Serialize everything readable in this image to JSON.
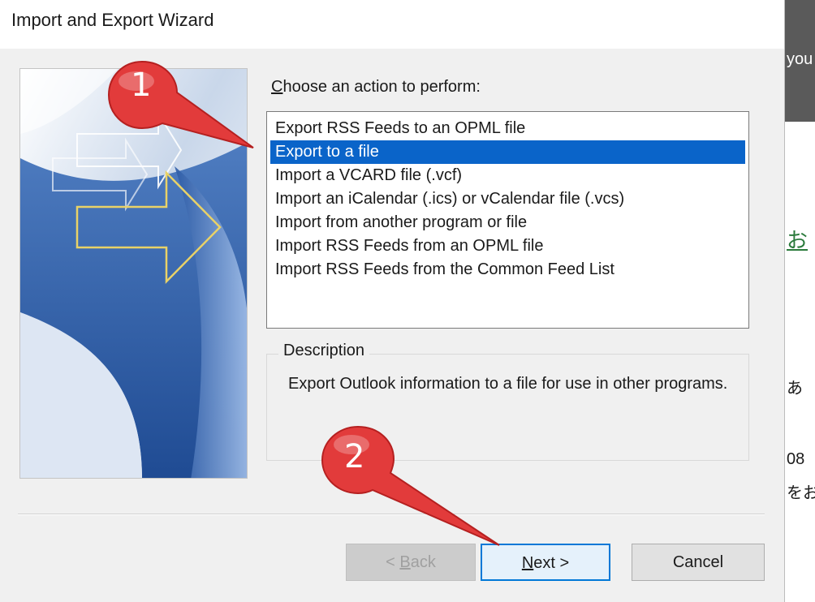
{
  "window": {
    "title": "Import and Export Wizard"
  },
  "prompt": {
    "label": "Choose an action to perform:",
    "access_key": "C",
    "rest": "hoose an action to perform:"
  },
  "actions": [
    {
      "label": "Export RSS Feeds to an OPML file",
      "selected": false
    },
    {
      "label": "Export to a file",
      "selected": true
    },
    {
      "label": "Import a VCARD file (.vcf)",
      "selected": false
    },
    {
      "label": "Import an iCalendar (.ics) or vCalendar file (.vcs)",
      "selected": false
    },
    {
      "label": "Import from another program or file",
      "selected": false
    },
    {
      "label": "Import RSS Feeds from an OPML file",
      "selected": false
    },
    {
      "label": "Import RSS Feeds from the Common Feed List",
      "selected": false
    }
  ],
  "description": {
    "legend": "Description",
    "text": "Export Outlook information to a file for use in other programs."
  },
  "buttons": {
    "back": {
      "label": "< Back",
      "pre": "< ",
      "key": "B",
      "rest": "ack",
      "enabled": false
    },
    "next": {
      "label": "Next >",
      "key": "N",
      "rest": "ext >"
    },
    "cancel": {
      "label": "Cancel"
    }
  },
  "callouts": {
    "step1": "1",
    "step2": "2"
  },
  "background_page": {
    "header_text": "you",
    "link_text": "お",
    "line1": "あ",
    "line2": "08",
    "line3": "をお"
  },
  "colors": {
    "selection": "#0a64c9",
    "callout": "#e23b3b",
    "accent": "#0078d7"
  }
}
